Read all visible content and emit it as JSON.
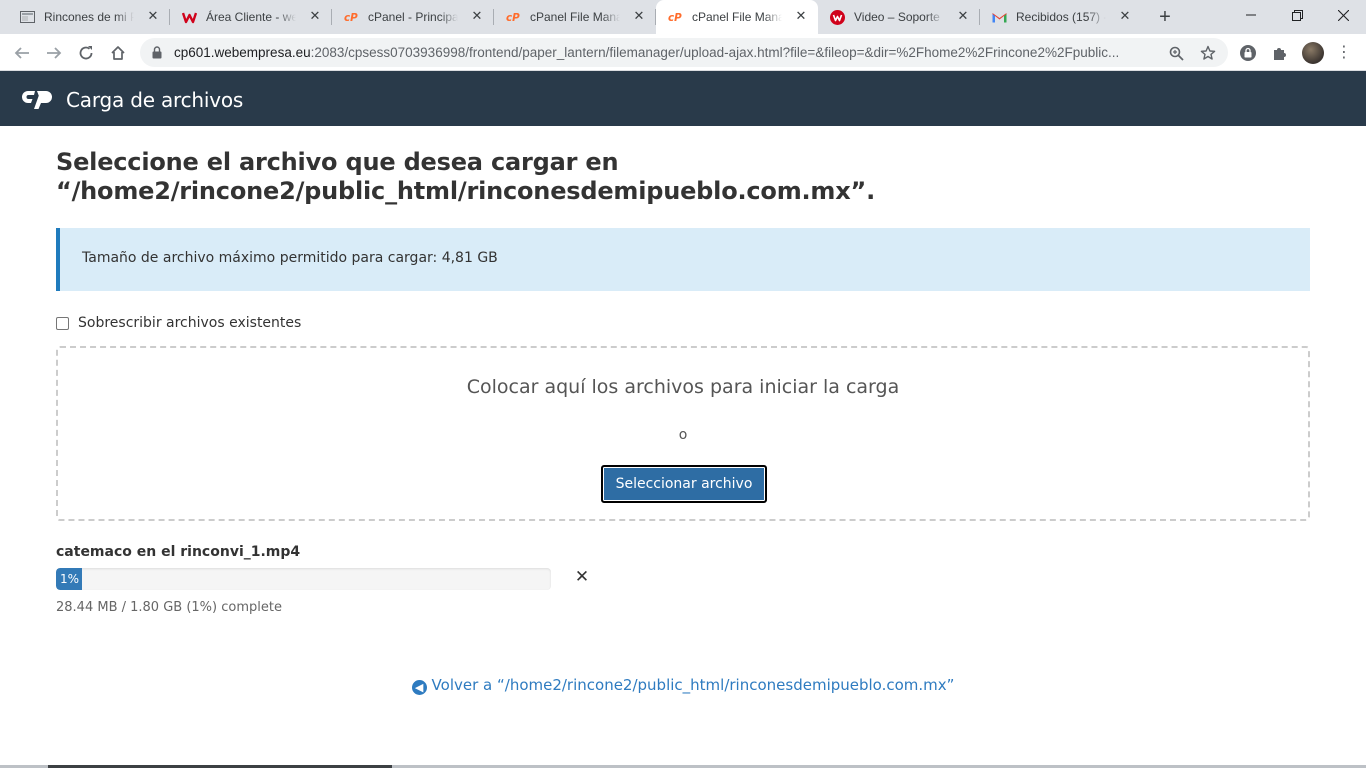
{
  "browser": {
    "tabs": [
      {
        "title": "Rincones de mi Pu",
        "icon": "site-icon",
        "active": false
      },
      {
        "title": "Área Cliente - web",
        "icon": "webempresa-icon",
        "active": false
      },
      {
        "title": "cPanel - Principal",
        "icon": "cpanel-icon",
        "active": false
      },
      {
        "title": "cPanel File Manage",
        "icon": "cpanel-icon",
        "active": false
      },
      {
        "title": "cPanel File Manage",
        "icon": "cpanel-icon",
        "active": true
      },
      {
        "title": "Video – Soporte D",
        "icon": "webempresa-icon",
        "active": false
      },
      {
        "title": "Recibidos (157) - n",
        "icon": "gmail-icon",
        "active": false
      }
    ],
    "url_host": "cp601.webempresa.eu",
    "url_rest": ":2083/cpsess0703936998/frontend/paper_lantern/filemanager/upload-ajax.html?file=&fileop=&dir=%2Fhome2%2Frincone2%2Fpublic..."
  },
  "header": {
    "title": "Carga de archivos"
  },
  "main": {
    "heading": "Seleccione el archivo que desea cargar en “/home2/rincone2/public_html/rinconesdemipueblo.com.mx”.",
    "info": "Tamaño de archivo máximo permitido para cargar: 4,81 GB",
    "overwrite_label": "Sobrescribir archivos existentes",
    "dropzone": {
      "text": "Colocar aquí los archivos para iniciar la carga",
      "or": "o",
      "button": "Seleccionar archivo"
    },
    "upload": {
      "file_name": "catemaco en el rinconvi_1.mp4",
      "progress_percent": 1,
      "progress_label": "1%",
      "status": "28.44 MB / 1.80 GB (1%) complete"
    },
    "back_link": "Volver a “/home2/rincone2/public_html/rinconesdemipueblo.com.mx”"
  },
  "colors": {
    "header_bg": "#293a4a",
    "accent": "#337ab7",
    "info_bg": "#d9ecf8"
  }
}
